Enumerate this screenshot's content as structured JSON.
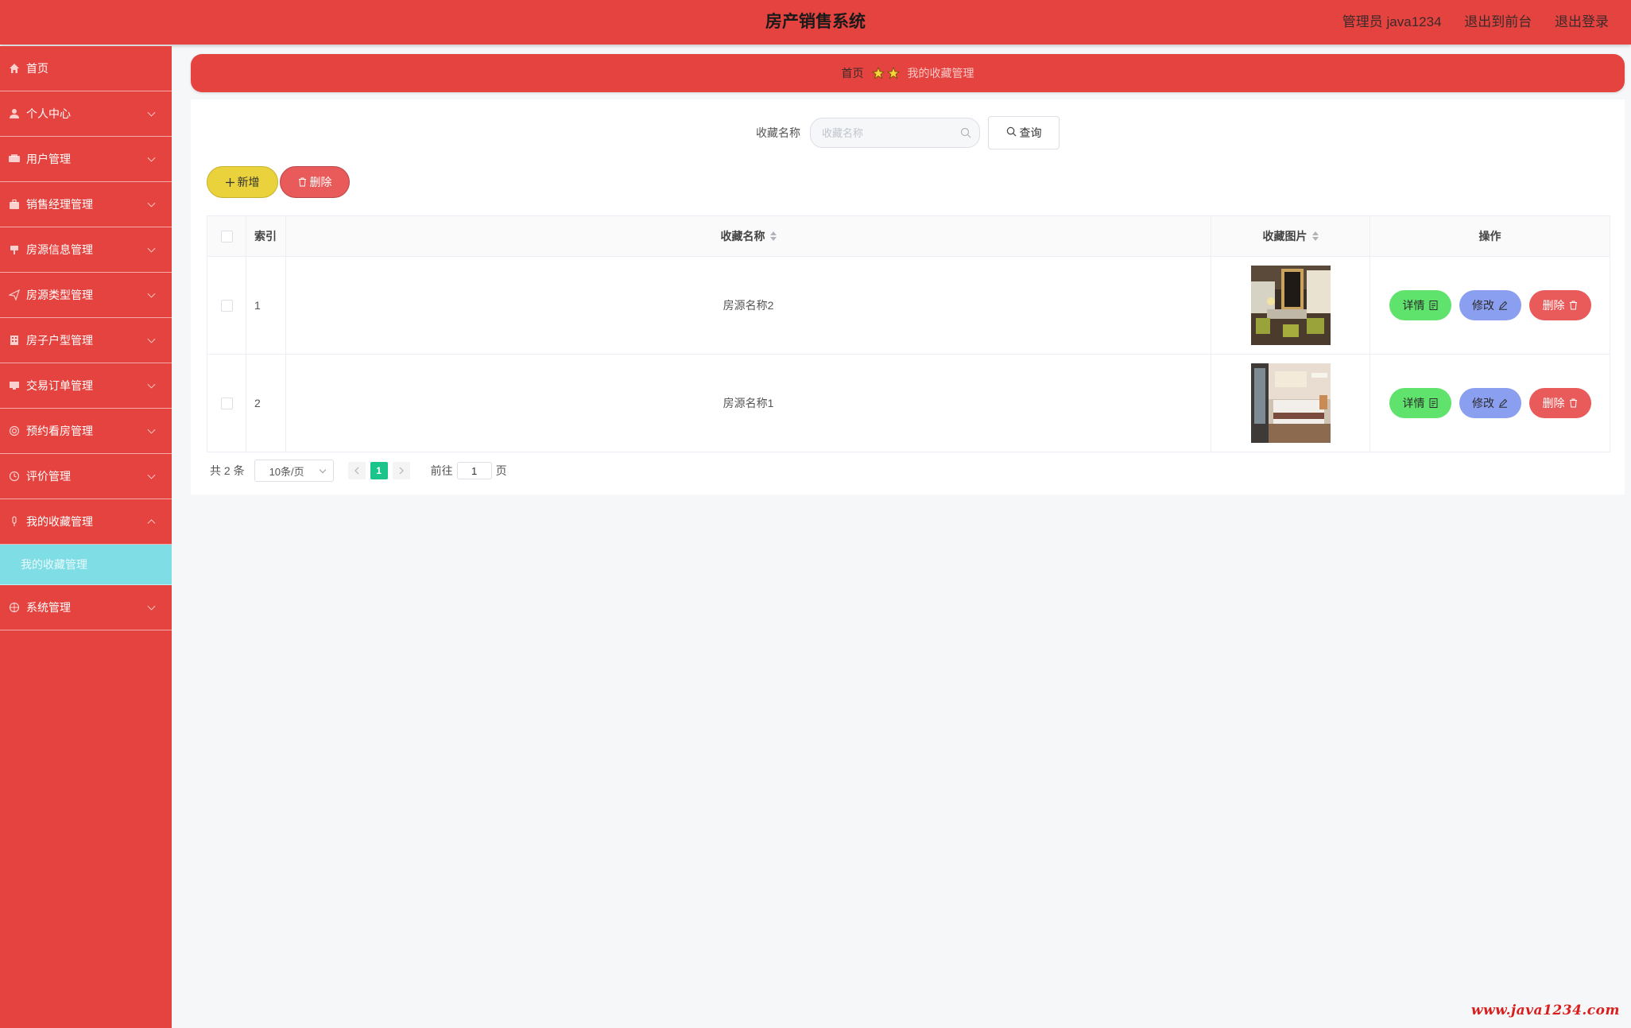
{
  "header": {
    "title": "房产销售系统",
    "admin": "管理员 java1234",
    "to_front": "退出到前台",
    "logout": "退出登录"
  },
  "sidebar": {
    "items": [
      {
        "label": "首页",
        "icon": "home-icon"
      },
      {
        "label": "个人中心",
        "icon": "user-icon"
      },
      {
        "label": "用户管理",
        "icon": "users-icon"
      },
      {
        "label": "销售经理管理",
        "icon": "briefcase-icon"
      },
      {
        "label": "房源信息管理",
        "icon": "sign-icon"
      },
      {
        "label": "房源类型管理",
        "icon": "send-icon"
      },
      {
        "label": "房子户型管理",
        "icon": "building-icon"
      },
      {
        "label": "交易订单管理",
        "icon": "monitor-icon"
      },
      {
        "label": "预约看房管理",
        "icon": "globe-icon"
      },
      {
        "label": "评价管理",
        "icon": "clock-icon"
      },
      {
        "label": "我的收藏管理",
        "icon": "microphone-icon"
      },
      {
        "label": "系统管理",
        "icon": "target-icon"
      }
    ],
    "active_sub": "我的收藏管理"
  },
  "breadcrumb": {
    "home": "首页",
    "current": "我的收藏管理"
  },
  "search": {
    "label": "收藏名称",
    "placeholder": "收藏名称",
    "button": "查询"
  },
  "actions": {
    "add": "新增",
    "delete": "删除"
  },
  "table": {
    "columns": [
      "索引",
      "收藏名称",
      "收藏图片",
      "操作"
    ],
    "rows": [
      {
        "index": "1",
        "name": "房源名称2",
        "image": "dining-room-photo"
      },
      {
        "index": "2",
        "name": "房源名称1",
        "image": "bedroom-photo"
      }
    ],
    "row_actions": {
      "detail": "详情",
      "edit": "修改",
      "delete": "删除"
    }
  },
  "pagination": {
    "total": "共 2 条",
    "page_size": "10条/页",
    "current": "1",
    "goto_label": "前往",
    "goto_value": "1",
    "page_suffix": "页"
  },
  "watermark": "www.java1234.com",
  "colors": {
    "brand": "#e5433f",
    "submenu_active": "#7fdde6",
    "detail": "#5fe36d",
    "edit": "#8b9ff0",
    "danger": "#e95a5a",
    "add": "#e9d23c",
    "pager_active": "#1bc48a"
  }
}
